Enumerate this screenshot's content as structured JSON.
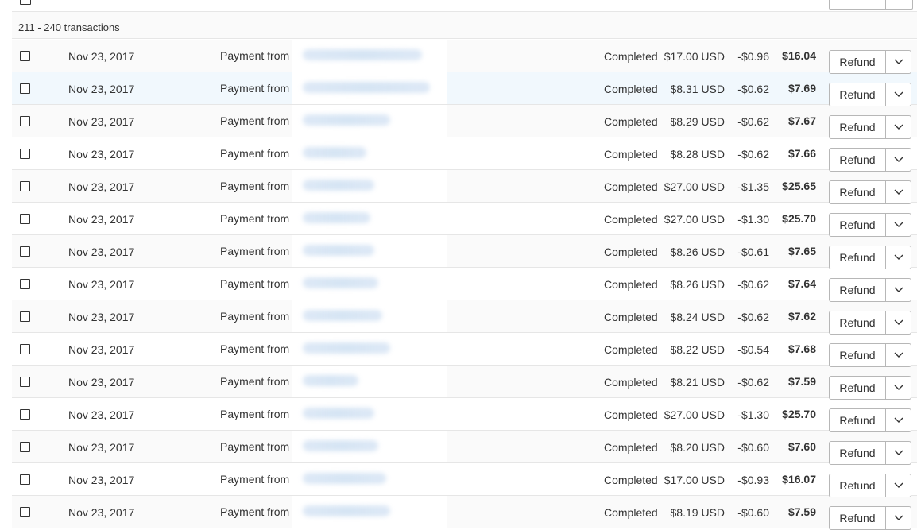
{
  "group_header": "211 - 240 transactions",
  "button": {
    "refund_label": "Refund"
  },
  "rows": [
    {
      "date": "Nov 23, 2017",
      "description": "Payment from",
      "status": "Completed",
      "gross": "$17.00 USD",
      "fee": "-$0.96",
      "net": "$16.04"
    },
    {
      "date": "Nov 23, 2017",
      "description": "Payment from",
      "status": "Completed",
      "gross": "$8.31 USD",
      "fee": "-$0.62",
      "net": "$7.69"
    },
    {
      "date": "Nov 23, 2017",
      "description": "Payment from",
      "status": "Completed",
      "gross": "$8.29 USD",
      "fee": "-$0.62",
      "net": "$7.67"
    },
    {
      "date": "Nov 23, 2017",
      "description": "Payment from",
      "status": "Completed",
      "gross": "$8.28 USD",
      "fee": "-$0.62",
      "net": "$7.66"
    },
    {
      "date": "Nov 23, 2017",
      "description": "Payment from",
      "status": "Completed",
      "gross": "$27.00 USD",
      "fee": "-$1.35",
      "net": "$25.65"
    },
    {
      "date": "Nov 23, 2017",
      "description": "Payment from",
      "status": "Completed",
      "gross": "$27.00 USD",
      "fee": "-$1.30",
      "net": "$25.70"
    },
    {
      "date": "Nov 23, 2017",
      "description": "Payment from",
      "status": "Completed",
      "gross": "$8.26 USD",
      "fee": "-$0.61",
      "net": "$7.65"
    },
    {
      "date": "Nov 23, 2017",
      "description": "Payment from",
      "status": "Completed",
      "gross": "$8.26 USD",
      "fee": "-$0.62",
      "net": "$7.64"
    },
    {
      "date": "Nov 23, 2017",
      "description": "Payment from",
      "status": "Completed",
      "gross": "$8.24 USD",
      "fee": "-$0.62",
      "net": "$7.62"
    },
    {
      "date": "Nov 23, 2017",
      "description": "Payment from",
      "status": "Completed",
      "gross": "$8.22 USD",
      "fee": "-$0.54",
      "net": "$7.68"
    },
    {
      "date": "Nov 23, 2017",
      "description": "Payment from",
      "status": "Completed",
      "gross": "$8.21 USD",
      "fee": "-$0.62",
      "net": "$7.59"
    },
    {
      "date": "Nov 23, 2017",
      "description": "Payment from",
      "status": "Completed",
      "gross": "$27.00 USD",
      "fee": "-$1.30",
      "net": "$25.70"
    },
    {
      "date": "Nov 23, 2017",
      "description": "Payment from",
      "status": "Completed",
      "gross": "$8.20 USD",
      "fee": "-$0.60",
      "net": "$7.60"
    },
    {
      "date": "Nov 23, 2017",
      "description": "Payment from",
      "status": "Completed",
      "gross": "$17.00 USD",
      "fee": "-$0.93",
      "net": "$16.07"
    },
    {
      "date": "Nov 23, 2017",
      "description": "Payment from",
      "status": "Completed",
      "gross": "$8.19 USD",
      "fee": "-$0.60",
      "net": "$7.59"
    }
  ],
  "icons": {
    "row_checkbox": "checkbox-icon",
    "dropdown": "chevron-down-icon"
  },
  "colors": {
    "row_bg": "#fafafa",
    "row_alt_bg": "#ffffff",
    "row_highlight_bg": "#f1f8fd",
    "border": "#e6e6e6",
    "button_border": "#b7b7b7",
    "redacted_name": "#c8dcf0"
  }
}
